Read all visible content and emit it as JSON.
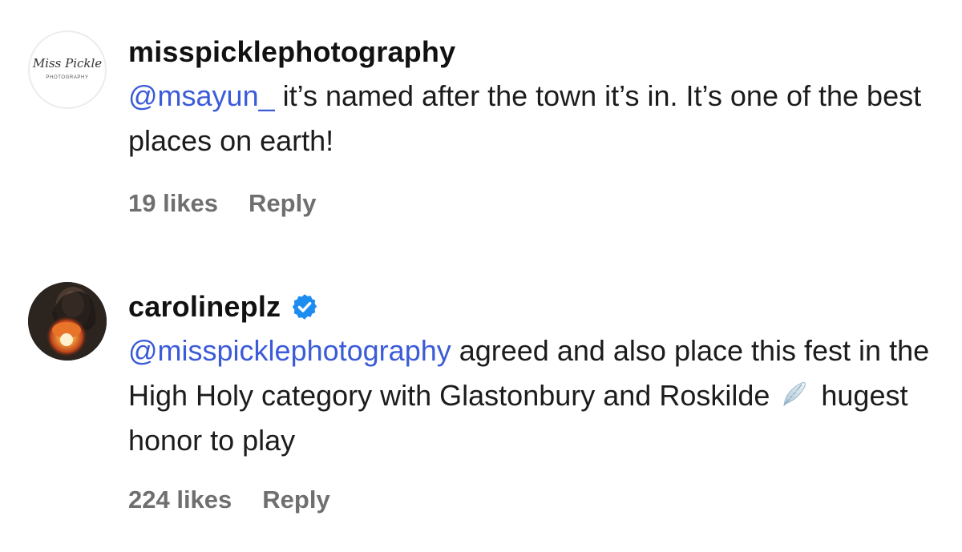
{
  "comments": [
    {
      "username": "misspicklephotography",
      "avatar_text": "Miss Pickle",
      "avatar_subtext": "PHOTOGRAPHY",
      "verified": false,
      "mention": "@msayun_",
      "text": " it’s named after the town it’s in. It’s one of the best places on earth!",
      "likes": "19 likes",
      "reply_label": "Reply"
    },
    {
      "username": "carolineplz",
      "verified": true,
      "verified_icon": "verified-badge-icon",
      "mention": "@misspicklephotography",
      "text_before_emoji": " agreed and also place this fest in the High Holy category with Glastonbury and Roskilde",
      "emoji": "feather-icon",
      "text_after_emoji": "hugest honor to play",
      "likes": "224 likes",
      "reply_label": "Reply"
    }
  ],
  "colors": {
    "mention": "#3b5bd8",
    "verified_badge": "#1d8cf0",
    "meta_text": "#6f6f6f"
  }
}
